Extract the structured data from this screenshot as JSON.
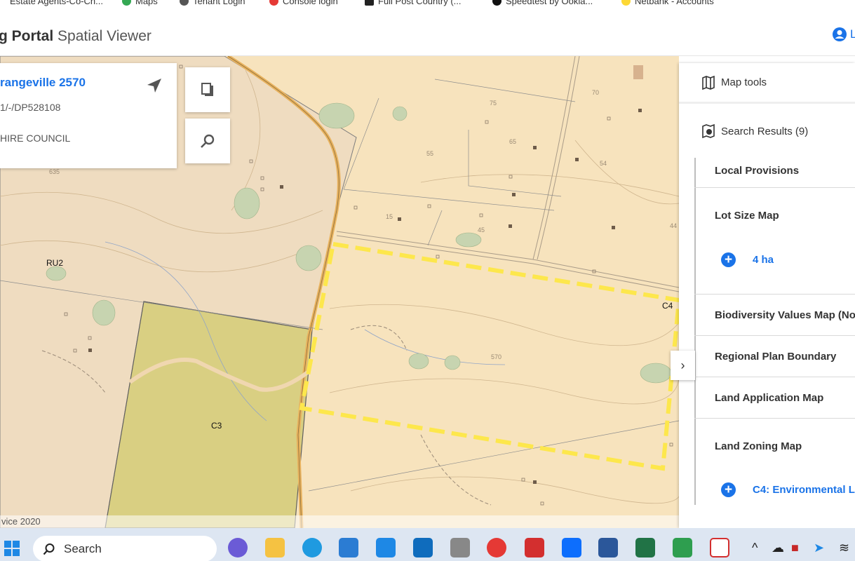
{
  "bookmarks": [
    "Estate Agents-Co-Ch...",
    "Maps",
    "Tenant Login",
    "Console login",
    "Full Post Country (...",
    "Speedtest by Ookla...",
    "Netbank - Accounts"
  ],
  "header": {
    "title_bold": "g Portal",
    "title_light": "Spatial Viewer",
    "user_label": "L"
  },
  "card": {
    "address": "rangeville 2570",
    "lot": "1/-/DP528108",
    "council": "HIRE COUNCIL"
  },
  "map_buttons": {
    "copy": "copy-icon",
    "zoom": "zoom-icon"
  },
  "map": {
    "zone_labels": [
      "RU2",
      "C3",
      "C4"
    ],
    "contour_labels": [
      "635",
      "570",
      "75",
      "65",
      "55",
      "54",
      "70",
      "44",
      "45",
      "15"
    ],
    "attribution": "vice 2020",
    "colors": {
      "base": "#f7e3bd",
      "c3_zone": "#d9cf82",
      "ru2_zone": "#efdcc0",
      "boundary": "#fde74c"
    }
  },
  "panel": {
    "map_tools": "Map tools",
    "search_results": "Search Results (9)",
    "items": [
      {
        "label": "Local Provisions"
      },
      {
        "label": "Lot Size Map",
        "sub": "4 ha"
      },
      {
        "label": "Biodiversity Values Map (Non-"
      },
      {
        "label": "Regional Plan Boundary"
      },
      {
        "label": "Land Application Map"
      },
      {
        "label": "Land Zoning Map",
        "sub": "C4: Environmental Liv"
      }
    ],
    "collapse": "›"
  },
  "taskbar": {
    "search_placeholder": "Search"
  }
}
